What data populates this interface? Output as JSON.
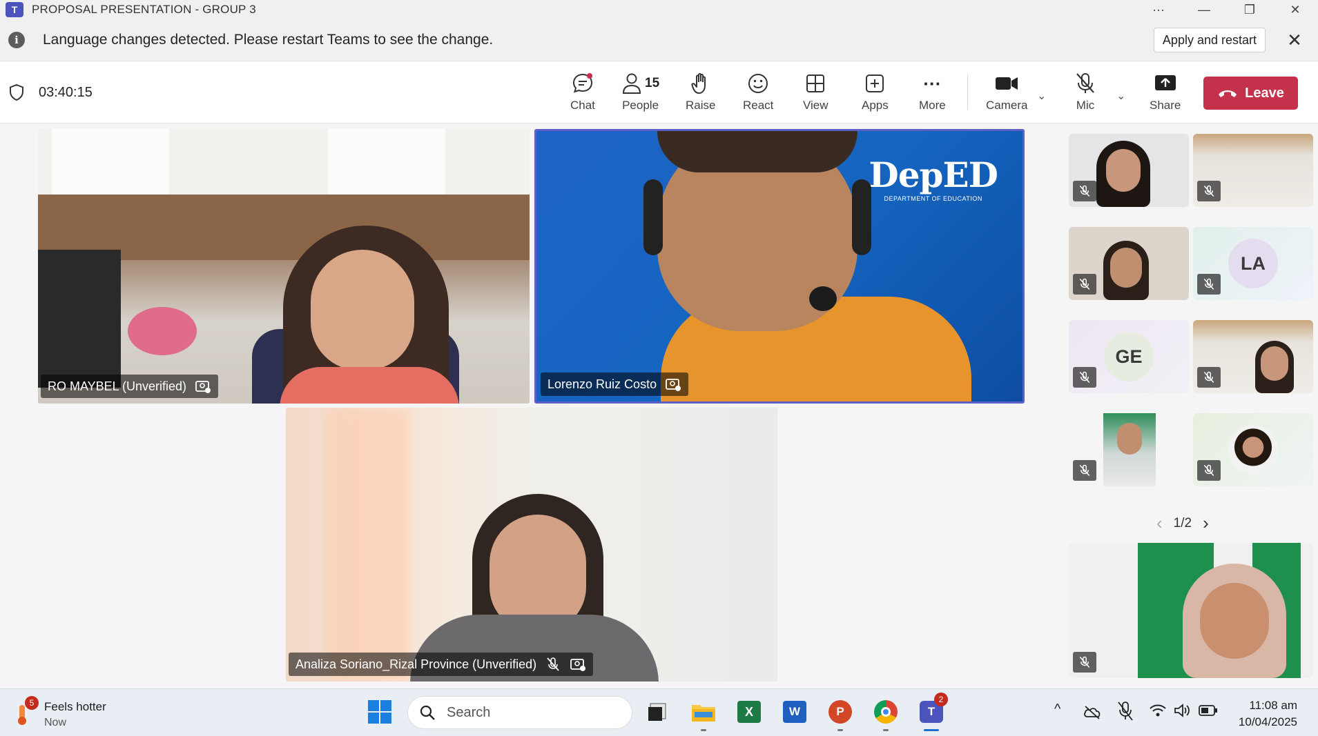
{
  "window": {
    "title": "PROPOSAL PRESENTATION - GROUP 3",
    "logo_letter": "T",
    "controls": [
      "···",
      "—",
      "❐",
      "✕"
    ]
  },
  "notification": {
    "message": "Language changes detected. Please restart Teams to see the change.",
    "apply_label": "Apply and restart",
    "close_glyph": "✕"
  },
  "toolbar": {
    "timer": "03:40:15",
    "chat_label": "Chat",
    "people_label": "People",
    "people_count": "15",
    "raise_label": "Raise",
    "react_label": "React",
    "view_label": "View",
    "apps_label": "Apps",
    "more_label": "More",
    "camera_label": "Camera",
    "mic_label": "Mic",
    "share_label": "Share",
    "leave_label": "Leave",
    "chevron_glyph": "⌄",
    "more_glyph": "···"
  },
  "participants": {
    "main": [
      {
        "name": "RO MAYBEL (Unverified)"
      },
      {
        "name": "Lorenzo Ruiz Costo",
        "logo_text": "DepED",
        "logo_sub": "DEPARTMENT OF EDUCATION"
      },
      {
        "name": "Analiza Soriano_Rizal Province (Unverified)"
      }
    ],
    "side_initials": [
      "LA",
      "GE"
    ],
    "pager": "1/2",
    "pager_prev": "‹",
    "pager_next": "›"
  },
  "taskbar": {
    "weather_title": "Feels hotter",
    "weather_sub": "Now",
    "weather_badge": "5",
    "search_placeholder": "Search",
    "teams_badge": "2",
    "time": "11:08 am",
    "date": "10/04/2025",
    "tray_caret": "^",
    "excel_letter": "X",
    "word_letter": "W",
    "ppt_letter": "P",
    "teams_letter": "T"
  },
  "colors": {
    "leave": "#c4314b",
    "accent": "#5b5fc7",
    "deped_blue": "#1565c0"
  }
}
